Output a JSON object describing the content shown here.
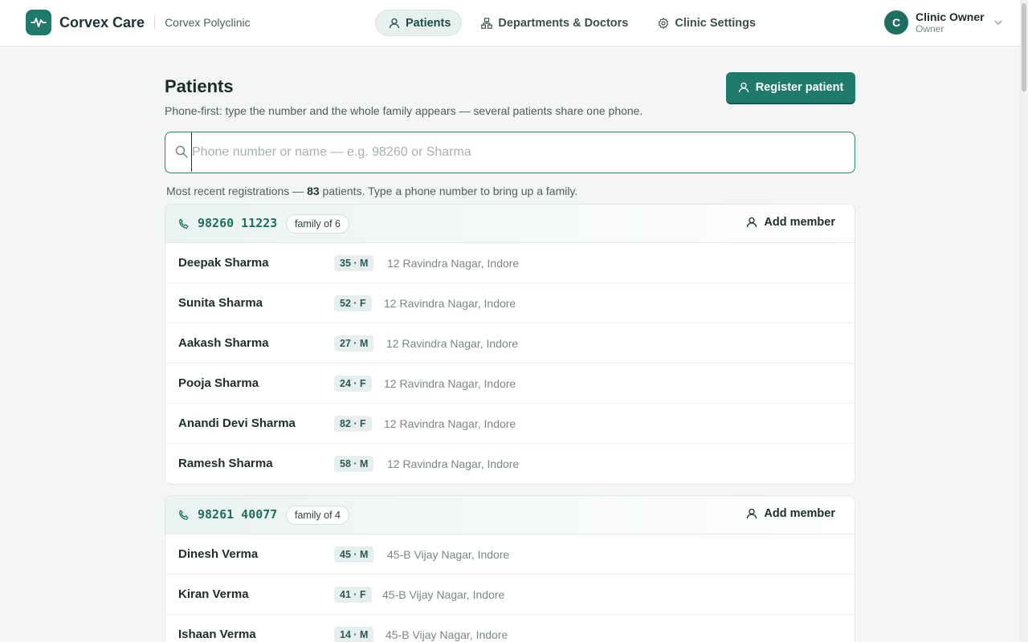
{
  "brand": {
    "name": "Corvex Care",
    "org": "Corvex Polyclinic"
  },
  "nav": [
    {
      "label": "Patients",
      "icon": "user-icon",
      "active": true
    },
    {
      "label": "Departments & Doctors",
      "icon": "hierarchy-icon",
      "active": false
    },
    {
      "label": "Clinic Settings",
      "icon": "gear-icon",
      "active": false
    }
  ],
  "user": {
    "initial": "C",
    "name": "Clinic Owner",
    "role": "Owner"
  },
  "page": {
    "title": "Patients",
    "subtitle": "Phone-first: type the number and the whole family appears — several patients share one phone.",
    "register_label": "Register patient"
  },
  "search": {
    "placeholder": "Phone number or name — e.g. 98260 or Sharma",
    "value": ""
  },
  "summary": {
    "prefix": "Most recent registrations — ",
    "count": "83",
    "suffix": " patients. Type a phone number to bring up a family."
  },
  "families": [
    {
      "phone": "98260 11223",
      "badge": "family of 6",
      "add_label": "Add member",
      "members": [
        {
          "name": "Deepak Sharma",
          "age": "35 · M",
          "address": "12 Ravindra Nagar, Indore"
        },
        {
          "name": "Sunita Sharma",
          "age": "52 · F",
          "address": "12 Ravindra Nagar, Indore"
        },
        {
          "name": "Aakash Sharma",
          "age": "27 · M",
          "address": "12 Ravindra Nagar, Indore"
        },
        {
          "name": "Pooja Sharma",
          "age": "24 · F",
          "address": "12 Ravindra Nagar, Indore"
        },
        {
          "name": "Anandi Devi Sharma",
          "age": "82 · F",
          "address": "12 Ravindra Nagar, Indore"
        },
        {
          "name": "Ramesh Sharma",
          "age": "58 · M",
          "address": "12 Ravindra Nagar, Indore"
        }
      ]
    },
    {
      "phone": "98261 40077",
      "badge": "family of 4",
      "add_label": "Add member",
      "members": [
        {
          "name": "Dinesh Verma",
          "age": "45 · M",
          "address": "45-B Vijay Nagar, Indore"
        },
        {
          "name": "Kiran Verma",
          "age": "41 · F",
          "address": "45-B Vijay Nagar, Indore"
        },
        {
          "name": "Ishaan Verma",
          "age": "14 · M",
          "address": "45-B Vijay Nagar, Indore"
        }
      ]
    }
  ],
  "colors": {
    "accent": "#1f7a6c",
    "accent_dark": "#1f6e62",
    "background": "#f3f6f5"
  }
}
